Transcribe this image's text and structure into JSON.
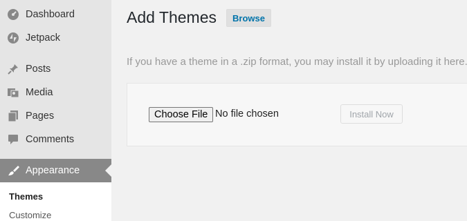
{
  "sidebar": {
    "items": [
      {
        "label": "Dashboard",
        "icon": "dashboard-icon"
      },
      {
        "label": "Jetpack",
        "icon": "jetpack-icon"
      },
      {
        "label": "Posts",
        "icon": "pin-icon"
      },
      {
        "label": "Media",
        "icon": "media-icon"
      },
      {
        "label": "Pages",
        "icon": "pages-icon"
      },
      {
        "label": "Comments",
        "icon": "comment-icon"
      },
      {
        "label": "Appearance",
        "icon": "brush-icon",
        "active": true
      }
    ],
    "submenu": [
      {
        "label": "Themes",
        "current": true
      },
      {
        "label": "Customize"
      }
    ]
  },
  "main": {
    "title": "Add Themes",
    "browse_label": "Browse",
    "help_text": "If you have a theme in a .zip format, you may install it by uploading it here.",
    "upload": {
      "choose_label": "Choose File",
      "file_status": "No file chosen",
      "install_label": "Install Now"
    }
  },
  "colors": {
    "sidebar_bg": "#e5e5e5",
    "active_bg": "#888888",
    "link": "#0073aa"
  }
}
